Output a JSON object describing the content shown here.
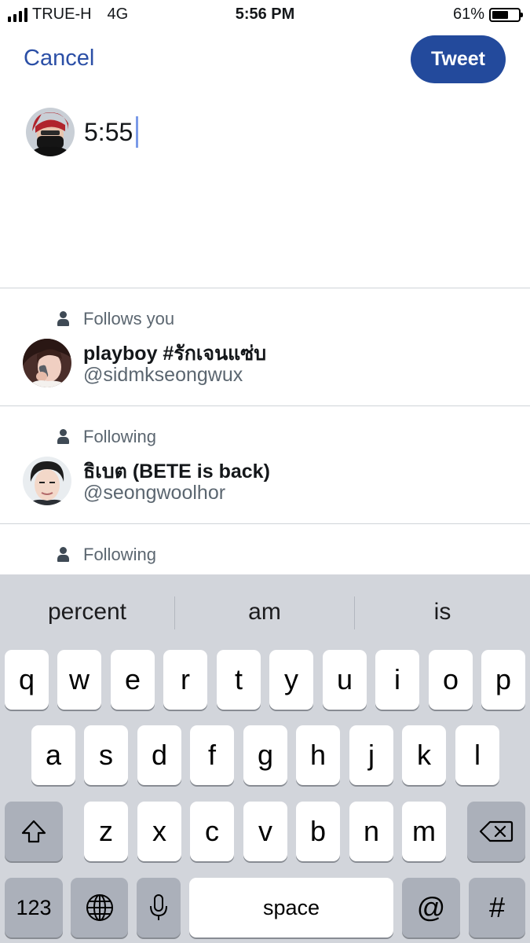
{
  "status_bar": {
    "carrier": "TRUE-H",
    "network": "4G",
    "time": "5:56 PM",
    "battery_text": "61%",
    "battery_level": 0.61,
    "signal_bars": 4
  },
  "compose": {
    "cancel_label": "Cancel",
    "tweet_label": "Tweet",
    "text": "5:55"
  },
  "suggestions": [
    {
      "relation": "Follows you",
      "name": "playboy #รักเจนแซ่บ",
      "handle": "@sidmkseongwux"
    },
    {
      "relation": "Following",
      "name": "ธิเบต  (BETE is back)",
      "handle": "@seongwoolhor"
    },
    {
      "relation": "Following",
      "name": "",
      "handle": ""
    }
  ],
  "keyboard": {
    "predictions": [
      "percent",
      "am",
      "is"
    ],
    "row1": [
      "q",
      "w",
      "e",
      "r",
      "t",
      "y",
      "u",
      "i",
      "o",
      "p"
    ],
    "row2": [
      "a",
      "s",
      "d",
      "f",
      "g",
      "h",
      "j",
      "k",
      "l"
    ],
    "row3": [
      "z",
      "x",
      "c",
      "v",
      "b",
      "n",
      "m"
    ],
    "numbers_label": "123",
    "space_label": "space",
    "at_label": "@",
    "hash_label": "#"
  },
  "colors": {
    "accent": "#234a9c",
    "link": "#2b4fa6",
    "caret": "#7a9ae8"
  }
}
